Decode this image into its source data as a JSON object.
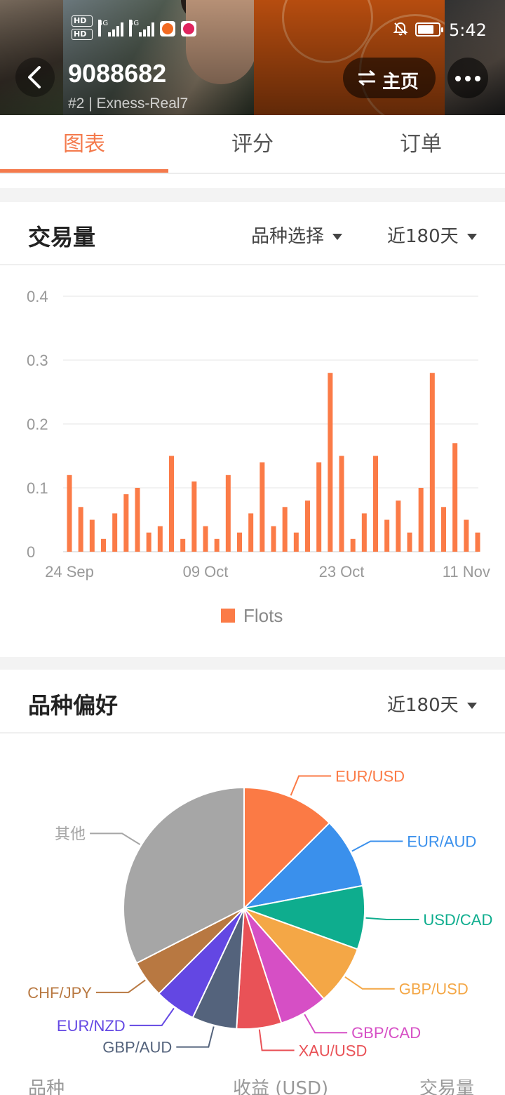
{
  "status_bar": {
    "hd_badges": [
      "HD",
      "HD"
    ],
    "network": [
      "4G",
      "4G"
    ],
    "time": "5:42"
  },
  "header": {
    "account_number": "9088682",
    "rank": "#2",
    "server": "Exness-Real7",
    "home_label": "主页",
    "icons": {
      "back": "chevron-left-icon",
      "home": "swap-arrows-icon",
      "more": "more-dots-icon"
    }
  },
  "tabs": [
    {
      "label": "图表",
      "active": true
    },
    {
      "label": "评分",
      "active": false
    },
    {
      "label": "订单",
      "active": false
    }
  ],
  "volume_section": {
    "title": "交易量",
    "symbol_filter": "品种选择",
    "period_filter": "近180天"
  },
  "preference_section": {
    "title": "品种偏好",
    "period_filter": "近180天"
  },
  "table_header": {
    "symbol": "品种",
    "profit": "收益 (USD)",
    "volume": "交易量"
  },
  "chart_data": [
    {
      "type": "bar",
      "y_ticks": [
        "0",
        "0.1",
        "0.2",
        "0.3",
        "0.4"
      ],
      "x_tick_labels": [
        "24 Sep",
        "09 Oct",
        "23 Oct",
        "11 Nov"
      ],
      "ylim": [
        0,
        0.4
      ],
      "grid": true,
      "legend_position": "bottom",
      "series": [
        {
          "name": "Flots",
          "color": "#fb7b47",
          "values": [
            0.12,
            0.07,
            0.05,
            0.02,
            0.06,
            0.09,
            0.1,
            0.03,
            0.04,
            0.15,
            0.02,
            0.11,
            0.04,
            0.02,
            0.12,
            0.03,
            0.06,
            0.14,
            0.04,
            0.07,
            0.03,
            0.08,
            0.14,
            0.28,
            0.15,
            0.02,
            0.06,
            0.15,
            0.05,
            0.08,
            0.03,
            0.1,
            0.28,
            0.07,
            0.17,
            0.05,
            0.03
          ]
        }
      ]
    },
    {
      "type": "pie",
      "slices": [
        {
          "label": "EUR/USD",
          "value": 12.5,
          "color": "#fb7a45"
        },
        {
          "label": "EUR/AUD",
          "value": 9.5,
          "color": "#3a90ec"
        },
        {
          "label": "USD/CAD",
          "value": 8.5,
          "color": "#0ead8e"
        },
        {
          "label": "GBP/USD",
          "value": 8.0,
          "color": "#f4a746"
        },
        {
          "label": "GBP/CAD",
          "value": 6.5,
          "color": "#d64fc5"
        },
        {
          "label": "XAU/USD",
          "value": 6.0,
          "color": "#e95257"
        },
        {
          "label": "GBP/AUD",
          "value": 6.0,
          "color": "#54637c"
        },
        {
          "label": "EUR/NZD",
          "value": 5.5,
          "color": "#6347e3"
        },
        {
          "label": "CHF/JPY",
          "value": 5.0,
          "color": "#b87841"
        },
        {
          "label": "其他",
          "value": 32.5,
          "color": "#a6a6a6"
        }
      ]
    }
  ]
}
